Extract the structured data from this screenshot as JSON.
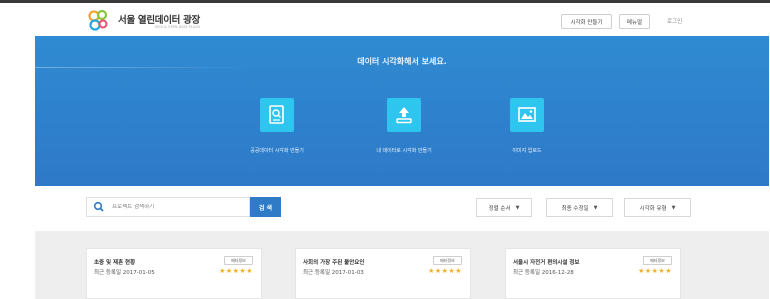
{
  "brand": {
    "title": "서울 열린데이터 광장",
    "subtitle": "SEOUL OPEN DATA PLAZA"
  },
  "header": {
    "create_button": "시각화 만들기",
    "menu_button": "메뉴얼",
    "login_link": "로그인"
  },
  "hero": {
    "title": "데이터 시각화해서 보세요.",
    "actions": [
      {
        "label": "공공데이터 시각화 만들기",
        "icon": "document-search-icon"
      },
      {
        "label": "내 데이터로 시각화 만들기",
        "icon": "upload-icon"
      },
      {
        "label": "이미지 업로드",
        "icon": "image-icon"
      }
    ]
  },
  "search": {
    "placeholder": "프로젝트 검색하기",
    "button": "검 색"
  },
  "filters": [
    {
      "label": "정렬 순서"
    },
    {
      "label": "최종 수정일"
    },
    {
      "label": "시각화 유형"
    }
  ],
  "cards": [
    {
      "title": "초중 및 재혼 현황",
      "date": "최근 등록일 2017-01-05",
      "meta": "메타정보",
      "stars": "★★★★★"
    },
    {
      "title": "사회의 가장 주된 불안요인",
      "date": "최근 등록일 2017-01-03",
      "meta": "메타정보",
      "stars": "★★★★★"
    },
    {
      "title": "서울시 자전거 편의시설 정보",
      "date": "최근 등록일 2016-12-28",
      "meta": "메타정보",
      "stars": "★★★★★"
    }
  ],
  "colors": {
    "hero_blue": "#2f82cd",
    "tile_cyan": "#2ec5ee",
    "search_button": "#2f7bc6",
    "star": "#f2b024"
  }
}
